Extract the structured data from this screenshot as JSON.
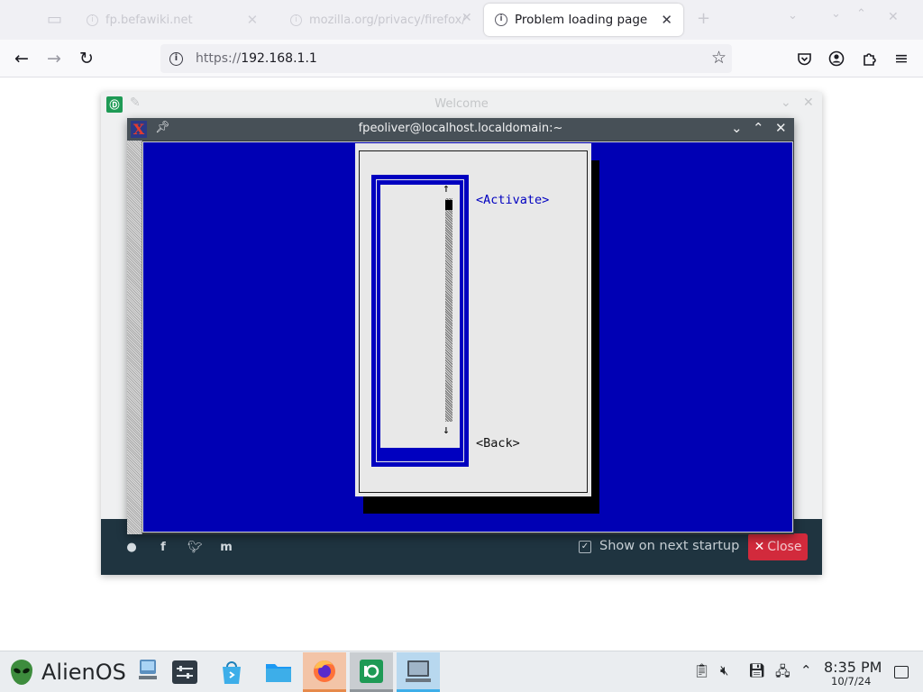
{
  "browser": {
    "tabs": [
      {
        "label": "fp.befawiki.net",
        "active": false
      },
      {
        "label": "mozilla.org/privacy/firefox/",
        "active": false
      },
      {
        "label": "Problem loading page",
        "active": true
      }
    ],
    "url_scheme": "https://",
    "url_host": "192.168.1.1"
  },
  "welcome": {
    "title": "Welcome",
    "show_on_startup_label": "Show on next startup",
    "show_on_startup_checked": true,
    "close_label": "Close"
  },
  "terminal": {
    "title": "fpeoliver@localhost.localdomain:~",
    "dialog": {
      "activate_label": "<Activate>",
      "back_label": "<Back>",
      "scroll_up": "↑",
      "scroll_down": "↓"
    }
  },
  "taskbar": {
    "start_label": "AlienOS",
    "clock_time": "8:35 PM",
    "clock_date": "10/7/24"
  },
  "colors": {
    "terminal_bg": "#0000b4",
    "close_button": "#d22a3c",
    "welcome_footer": "#1f3440"
  }
}
